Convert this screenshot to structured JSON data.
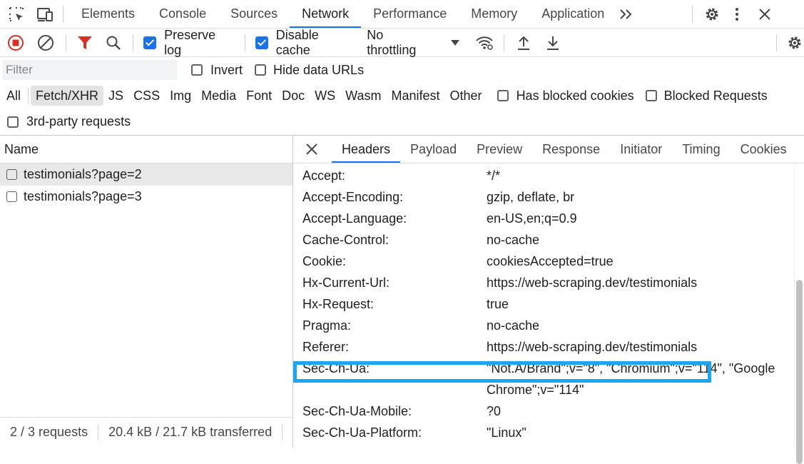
{
  "tabs": [
    "Elements",
    "Console",
    "Sources",
    "Network",
    "Performance",
    "Memory",
    "Application"
  ],
  "toolbar": {
    "preserve_log": "Preserve log",
    "disable_cache": "Disable cache",
    "throttling": "No throttling"
  },
  "filter": {
    "placeholder": "Filter",
    "invert": "Invert",
    "hide_data_urls": "Hide data URLs"
  },
  "types": [
    "All",
    "Fetch/XHR",
    "JS",
    "CSS",
    "Img",
    "Media",
    "Font",
    "Doc",
    "WS",
    "Wasm",
    "Manifest",
    "Other"
  ],
  "type_checks": {
    "has_blocked_cookies": "Has blocked cookies",
    "blocked_requests": "Blocked Requests",
    "third_party": "3rd-party requests"
  },
  "requests": {
    "header": "Name",
    "items": [
      "testimonials?page=2",
      "testimonials?page=3"
    ]
  },
  "status": {
    "requests": "2 / 3 requests",
    "transferred": "20.4 kB / 21.7 kB transferred"
  },
  "detail_tabs": [
    "Headers",
    "Payload",
    "Preview",
    "Response",
    "Initiator",
    "Timing",
    "Cookies"
  ],
  "headers": [
    {
      "key": "Accept:",
      "value": "*/*"
    },
    {
      "key": "Accept-Encoding:",
      "value": "gzip, deflate, br"
    },
    {
      "key": "Accept-Language:",
      "value": "en-US,en;q=0.9"
    },
    {
      "key": "Cache-Control:",
      "value": "no-cache"
    },
    {
      "key": "Cookie:",
      "value": "cookiesAccepted=true"
    },
    {
      "key": "Hx-Current-Url:",
      "value": "https://web-scraping.dev/testimonials"
    },
    {
      "key": "Hx-Request:",
      "value": "true"
    },
    {
      "key": "Pragma:",
      "value": "no-cache"
    },
    {
      "key": "Referer:",
      "value": "https://web-scraping.dev/testimonials"
    },
    {
      "key": "Sec-Ch-Ua:",
      "value": "\"Not.A/Brand\";v=\"8\", \"Chromium\";v=\"114\", \"Google Chrome\";v=\"114\""
    },
    {
      "key": "Sec-Ch-Ua-Mobile:",
      "value": "?0"
    },
    {
      "key": "Sec-Ch-Ua-Platform:",
      "value": "\"Linux\""
    }
  ],
  "colors": {
    "accent": "#1a73e8",
    "record_stop": "#d93025",
    "filter_active": "#d93025",
    "highlight_box": "#1aa6f2"
  }
}
